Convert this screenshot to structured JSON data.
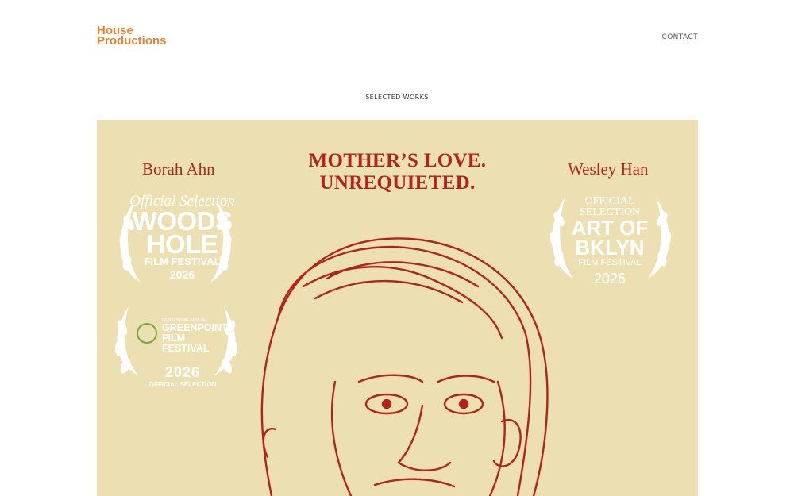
{
  "header": {
    "logo_line1": "House",
    "logo_line2": "Productions",
    "contact_label": "CONTACT"
  },
  "section": {
    "title": "SELECTED WORKS"
  },
  "poster": {
    "name_left": "Borah Ahn",
    "name_right": "Wesley Han",
    "tagline_line1": "MOTHER’S LOVE.",
    "tagline_line2": "UNREQUIETED.",
    "laurel_woods_hole": {
      "line1": "Official Selection",
      "line2": "WOODS",
      "line3": "HOLE",
      "line4": "FILM FESTIVAL",
      "year": "2026"
    },
    "laurel_art_of_bklyn": {
      "line1": "OFFICIAL",
      "line2": "SELECTION",
      "line3": "ART OF",
      "line4": "BKLYN",
      "line5": "FILM FESTIVAL",
      "year": "2026"
    },
    "laurel_greenpoint": {
      "small": "FILMFESTIVAL ANNUAL",
      "line1": "GREENPOINT",
      "line2": "FILM FESTIVAL",
      "year": "2026",
      "selection": "OFFICIAL SELECTION"
    }
  },
  "colors": {
    "accent": "#e8822f",
    "poster_bg": "#ece0b2",
    "poster_red": "#b3231c"
  }
}
